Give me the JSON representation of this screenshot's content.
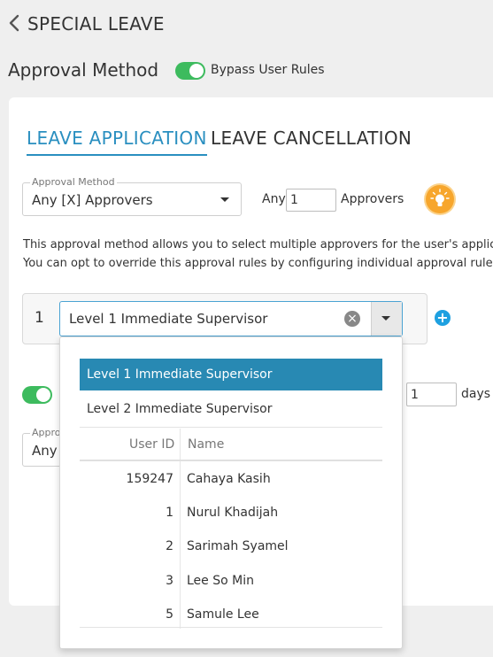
{
  "header": {
    "title": "SPECIAL LEAVE",
    "back_icon": "chevron-left-icon"
  },
  "section": {
    "title": "Approval Method",
    "bypass_toggle": {
      "label": "Bypass User Rules",
      "on": true
    }
  },
  "tabs": [
    {
      "label": "LEAVE APPLICATION",
      "active": true
    },
    {
      "label": "LEAVE CANCELLATION",
      "active": false
    }
  ],
  "approval_method": {
    "field_label": "Approval Method",
    "value": "Any [X] Approvers",
    "any_label": "Any",
    "count": "1",
    "approvers_label": "Approvers",
    "hint_icon": "lightbulb-icon"
  },
  "description": {
    "line1": "This approval method allows you to select multiple approvers for the user's applic",
    "line2": "You can opt to override this approval rules by configuring individual approval rule:"
  },
  "level_row": {
    "number": "1",
    "value": "Level 1 Immediate Supervisor",
    "clear_icon": "clear-circle-icon",
    "add_icon": "plus-circle-icon"
  },
  "background": {
    "days_value": "1",
    "days_label": "days",
    "field_label": "Appro",
    "value": "Any",
    "toggle_on": true
  },
  "dropdown": {
    "options": [
      "Level 1 Immediate Supervisor",
      "Level 2 Immediate Supervisor"
    ],
    "selected_index": 0,
    "columns": [
      "User ID",
      "Name"
    ],
    "rows": [
      {
        "id": "159247",
        "name": "Cahaya Kasih"
      },
      {
        "id": "1",
        "name": "Nurul Khadijah"
      },
      {
        "id": "2",
        "name": "Sarimah Syamel"
      },
      {
        "id": "3",
        "name": "Lee So Min"
      },
      {
        "id": "5",
        "name": "Samule Lee"
      }
    ]
  },
  "colors": {
    "accent": "#2a8fc0",
    "selected": "#2889b3",
    "toggle": "#3dbb5e",
    "bulb": "#f7a62c",
    "add": "#1ea0e0"
  }
}
